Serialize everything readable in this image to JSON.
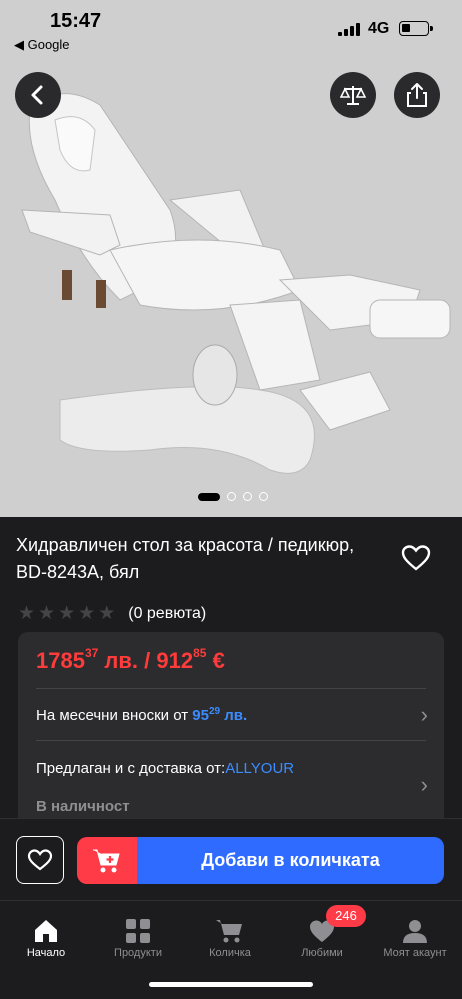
{
  "status": {
    "time": "15:47",
    "back_app": "◀ Google",
    "network": "4G"
  },
  "product": {
    "title": "Хидравличен стол за красота / педикюр, BD-8243A, бял",
    "rating_stars": 0,
    "reviews": "(0 ревюта)",
    "gallery_total": 4,
    "gallery_active": 1
  },
  "price": {
    "bgn_int": "1785",
    "bgn_dec": "37",
    "bgn_cur": " лв. / ",
    "eur_int": "912",
    "eur_dec": "85",
    "eur_cur": " €"
  },
  "installments": {
    "label": "На месечни вноски от ",
    "amount_int": "95",
    "amount_dec": "29",
    "currency": " лв."
  },
  "seller": {
    "label": "Предлаган и с доставка от:",
    "name": "ALLYOUR"
  },
  "availability": "В наличност",
  "actions": {
    "add_to_cart": "Добави в количката"
  },
  "tabs": [
    {
      "label": "Начало",
      "icon": "home-icon"
    },
    {
      "label": "Продукти",
      "icon": "grid-icon"
    },
    {
      "label": "Количка",
      "icon": "cart-icon"
    },
    {
      "label": "Любими",
      "icon": "heart-icon",
      "badge": "246"
    },
    {
      "label": "Моят акаунт",
      "icon": "user-icon"
    }
  ],
  "colors": {
    "price": "#ff3b3b",
    "accent_blue": "#2f6bff",
    "cart_red": "#ff3b47"
  }
}
